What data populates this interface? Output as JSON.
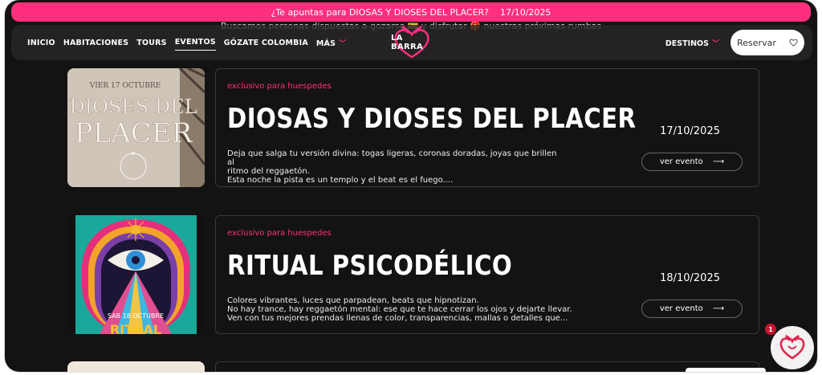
{
  "announcement": {
    "text": "¿Te apuntas para DIOSAS Y DIOSES DEL PLACER?",
    "date": "17/10/2025"
  },
  "background_heading": {
    "sub": "Buscamos personas dispuestas a gozarse 🎫 y disfrutar 🎁 nuestras próximas rumbas"
  },
  "nav": {
    "items": [
      "INICIO",
      "HABITACIONES",
      "TOURS",
      "EVENTOS",
      "GÓZATE COLOMBIA",
      "MÁS"
    ],
    "active": "EVENTOS",
    "logo": "LA BARRA",
    "destinos": "DESTINOS",
    "reservar": "Reservar"
  },
  "events": [
    {
      "tag": "exclusivo para huespedes",
      "title": "DIOSAS Y DIOSES DEL PLACER",
      "desc": [
        "Deja que salga tu versión divina: togas ligeras, coronas doradas, joyas que brillen al",
        "ritmo del reggaetón.",
        "Esta noche la pista es un templo y el beat es el fuego...."
      ],
      "date": "17/10/2025",
      "button": "ver evento",
      "poster": {
        "date_line": "VIER 17 OCTUBRE",
        "line1": "DIOSES DEL",
        "line2": "PLACER"
      }
    },
    {
      "tag": "exclusivo para huespedes",
      "title": "RITUAL PSICODÉLICO",
      "desc": [
        "Colores vibrantes, luces que parpadean, beats que hipnotizan.",
        "No hay trance, hay reggaetón mental: ese que te hace cerrar los ojos y dejarte llevar.",
        "Ven con tus mejores prendas llenas de color, transparencias, mallas o detalles que..."
      ],
      "date": "18/10/2025",
      "button": "ver evento",
      "poster": {
        "date_line": "SAB 18 OCTUBRE",
        "line1": "RITUAL"
      }
    }
  ],
  "chat": {
    "badge": "1"
  },
  "colors": {
    "accent": "#ff2f7e",
    "bg": "#141313"
  }
}
